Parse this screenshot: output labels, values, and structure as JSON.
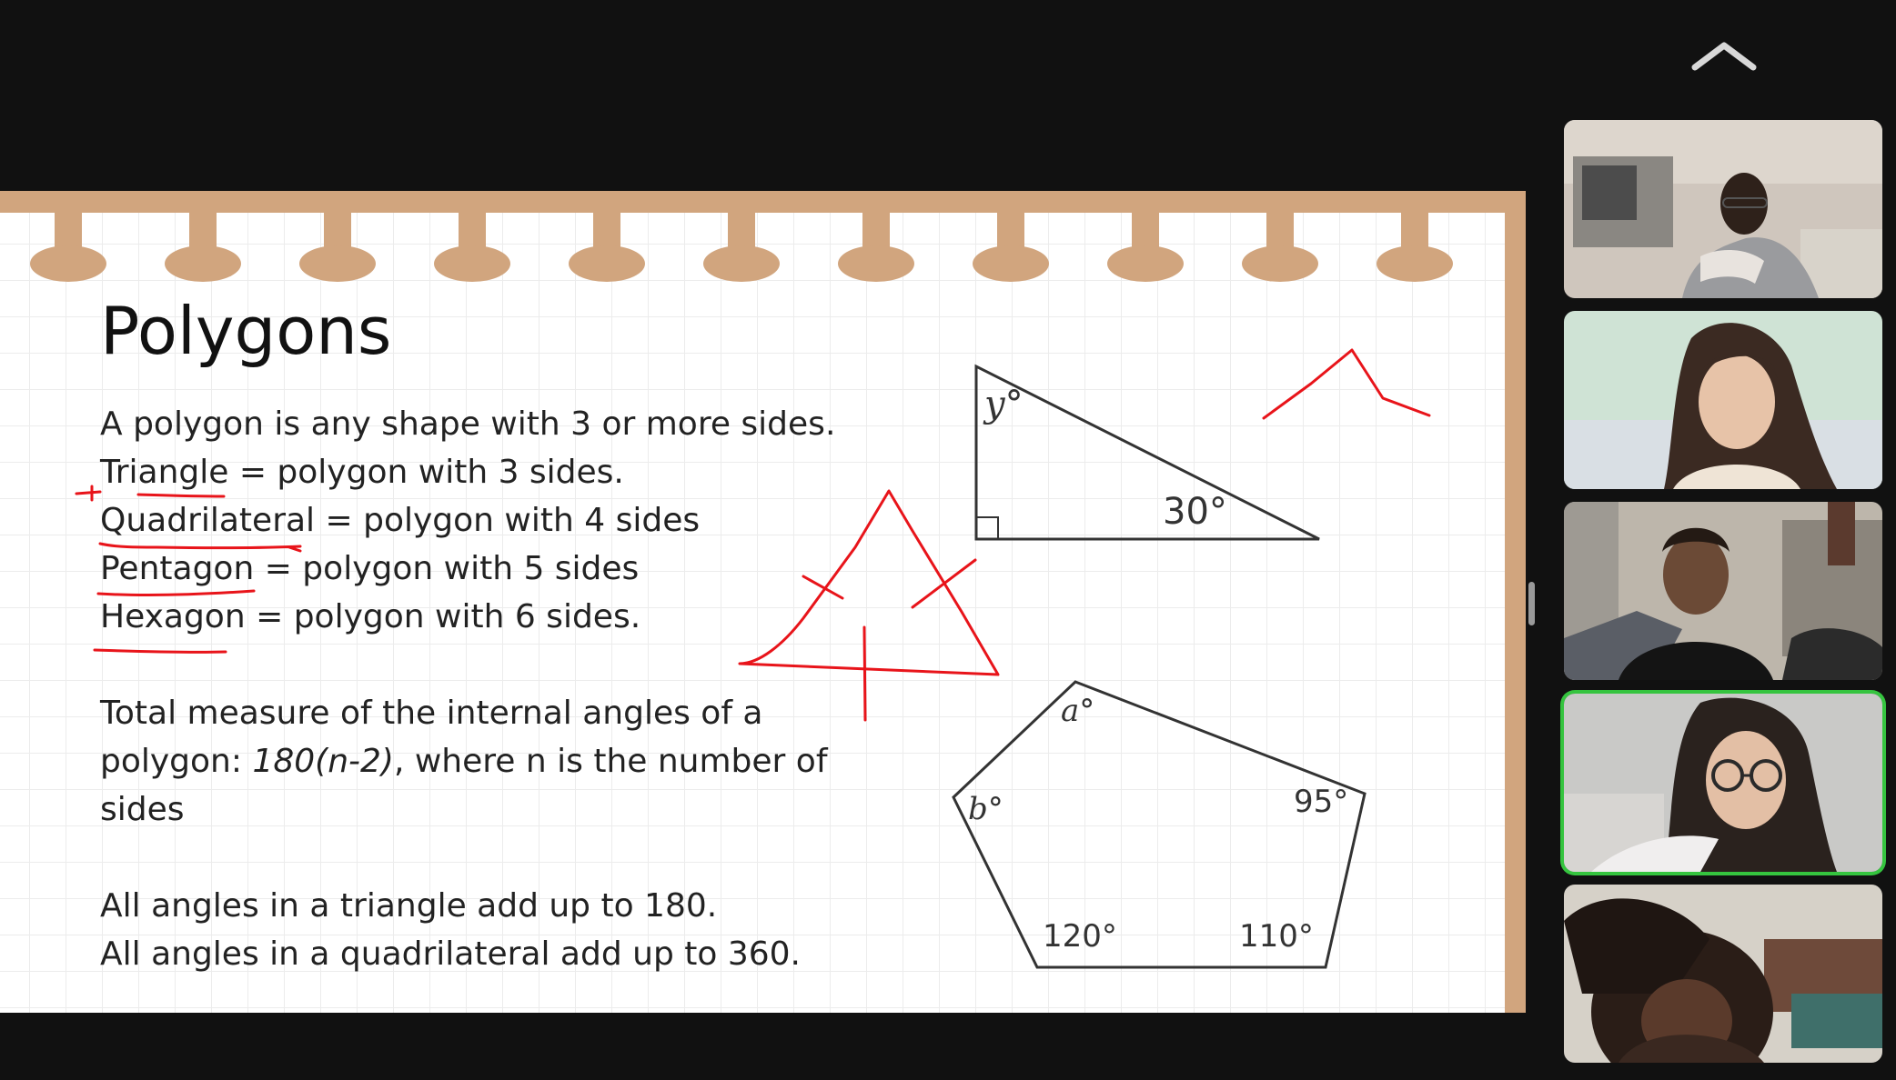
{
  "controls": {
    "collapse_icon": "chevron-up-icon"
  },
  "slide": {
    "title": "Polygons",
    "definitions": [
      "A polygon is any shape with 3 or more sides.",
      "Triangle = polygon with 3 sides.",
      "Quadrilateral = polygon with 4 sides",
      "Pentagon = polygon with 5 sides",
      "Hexagon = polygon with 6 sides."
    ],
    "formula": {
      "line1": "Total measure of the internal angles of a",
      "line2_prefix": "polygon: ",
      "line2_formula": "180(n-2)",
      "line2_suffix": ", where n is the number of",
      "line3": "sides"
    },
    "sums": [
      "All angles in a triangle add up to 180.",
      "All angles in a quadrilateral add up to 360."
    ],
    "triangle_labels": {
      "top_angle": "y°",
      "right_angle": "30°"
    },
    "pentagon_labels": {
      "top": "a°",
      "left": "b°",
      "right": "95°",
      "bottom_left": "120°",
      "bottom_right": "110°"
    },
    "colors": {
      "annotation": "#e8141a",
      "slide_border": "#d1a57e",
      "active_speaker": "#35c43f"
    }
  },
  "participants": [
    {
      "id": 1,
      "active": false
    },
    {
      "id": 2,
      "active": false
    },
    {
      "id": 3,
      "active": false
    },
    {
      "id": 4,
      "active": true
    },
    {
      "id": 5,
      "active": false
    }
  ]
}
